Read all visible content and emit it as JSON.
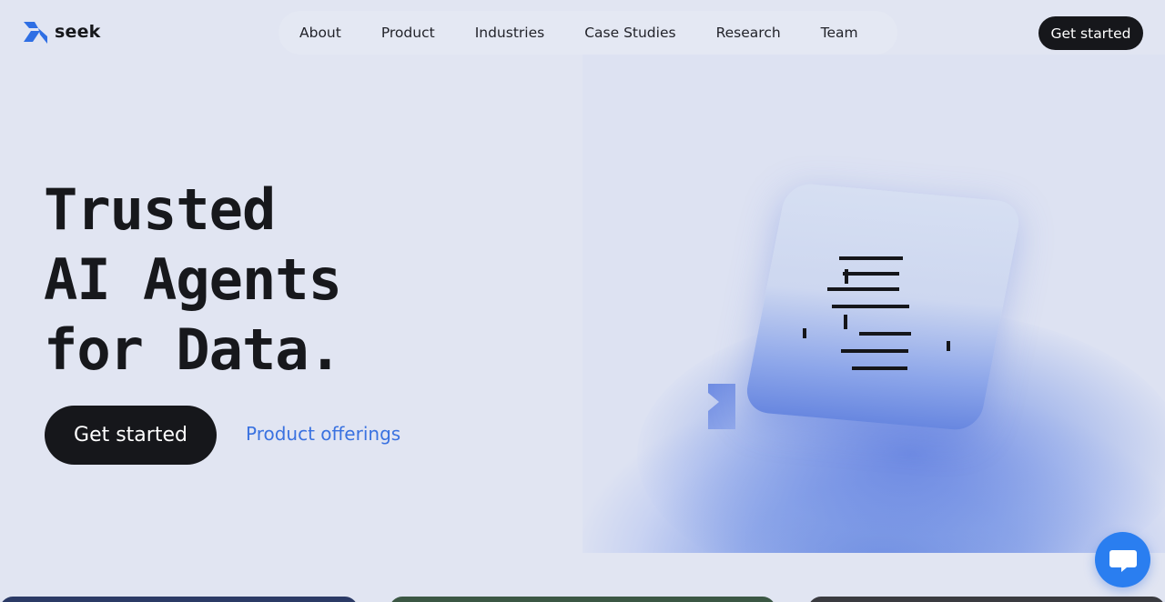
{
  "brand": {
    "name": "seek",
    "logo_icon": "seek-logo-icon",
    "accent": "#2f6fe4"
  },
  "nav": {
    "items": [
      {
        "label": "About"
      },
      {
        "label": "Product"
      },
      {
        "label": "Industries"
      },
      {
        "label": "Case Studies"
      },
      {
        "label": "Research"
      },
      {
        "label": "Team"
      }
    ]
  },
  "header": {
    "cta_label": "Get started"
  },
  "hero": {
    "headline": [
      "Trusted",
      "AI Agents",
      "for Data."
    ],
    "cta_label": "Get started",
    "secondary_label": "Product offerings"
  },
  "visual": {
    "icon": "document-lines-illustration"
  },
  "chat": {
    "icon": "chat-bubble-icon",
    "color": "#2a7ef0"
  },
  "colors": {
    "background": "#e1e5f2",
    "dark_button": "#16171b",
    "link": "#3a72e0"
  }
}
